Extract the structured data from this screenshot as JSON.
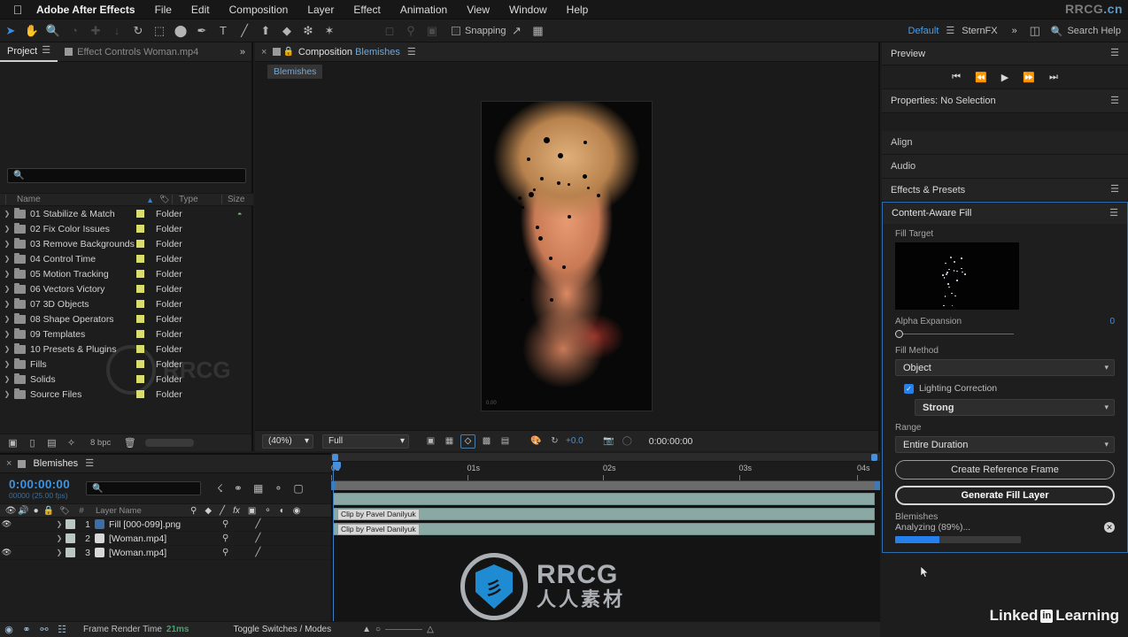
{
  "menubar": {
    "apple_icon": "apple-icon",
    "app_name": "Adobe After Effects",
    "items": [
      "File",
      "Edit",
      "Composition",
      "Layer",
      "Effect",
      "Animation",
      "View",
      "Window",
      "Help"
    ],
    "watermark_right": "RRCG",
    "watermark_right_suffix": ".cn"
  },
  "toolbar": {
    "tools": [
      {
        "name": "selection-tool",
        "glyph": "➤"
      },
      {
        "name": "hand-tool",
        "glyph": "✋"
      },
      {
        "name": "zoom-tool",
        "glyph": "🔍"
      },
      {
        "name": "orbit-tool",
        "glyph": "◔"
      },
      {
        "name": "pan-behind-tool",
        "glyph": "✚"
      },
      {
        "name": "move-tool",
        "glyph": "↓"
      },
      {
        "name": "rotation-tool",
        "glyph": "↺"
      },
      {
        "name": "anchor-point-tool",
        "glyph": "⬚"
      },
      {
        "name": "shape-tool",
        "glyph": "⬤"
      },
      {
        "name": "pen-tool",
        "glyph": "✒"
      },
      {
        "name": "type-tool",
        "glyph": "T"
      },
      {
        "name": "brush-tool",
        "glyph": "╱"
      },
      {
        "name": "clone-stamp-tool",
        "glyph": "⬆"
      },
      {
        "name": "eraser-tool",
        "glyph": "◆"
      },
      {
        "name": "roto-brush-tool",
        "glyph": "❇"
      },
      {
        "name": "puppet-pin-tool",
        "glyph": "✦"
      }
    ],
    "snapping_label": "Snapping",
    "workspace_active": "Default",
    "workspace_other": "SternFX",
    "workspace_more": "»",
    "search_help_placeholder": "Search Help"
  },
  "project_panel": {
    "tabs": [
      {
        "label": "Project",
        "active": true
      },
      {
        "label": "Effect Controls Woman.mp4",
        "active": false
      }
    ],
    "search_placeholder": "",
    "columns": [
      "Name",
      "Type",
      "Size"
    ],
    "items": [
      {
        "name": "01 Stabilize & Match",
        "type": "Folder",
        "size": "",
        "has_extra": true
      },
      {
        "name": "02 Fix Color Issues",
        "type": "Folder",
        "size": "",
        "has_extra": false
      },
      {
        "name": "03 Remove Backgrounds",
        "type": "Folder",
        "size": "",
        "has_extra": false
      },
      {
        "name": "04 Control Time",
        "type": "Folder",
        "size": "",
        "has_extra": false
      },
      {
        "name": "05 Motion Tracking",
        "type": "Folder",
        "size": "",
        "has_extra": false
      },
      {
        "name": "06 Vectors Victory",
        "type": "Folder",
        "size": "",
        "has_extra": false
      },
      {
        "name": "07 3D Objects",
        "type": "Folder",
        "size": "",
        "has_extra": false
      },
      {
        "name": "08 Shape Operators",
        "type": "Folder",
        "size": "",
        "has_extra": false
      },
      {
        "name": "09 Templates",
        "type": "Folder",
        "size": "",
        "has_extra": false
      },
      {
        "name": "10 Presets & Plugins",
        "type": "Folder",
        "size": "",
        "has_extra": false
      },
      {
        "name": "Fills",
        "type": "Folder",
        "size": "",
        "has_extra": false
      },
      {
        "name": "Solids",
        "type": "Folder",
        "size": "",
        "has_extra": false
      },
      {
        "name": "Source Files",
        "type": "Folder",
        "size": "",
        "has_extra": false
      }
    ],
    "footer": {
      "bit_depth": "8 bpc"
    }
  },
  "composition": {
    "tab_prefix": "Composition",
    "tab_name": "Blemishes",
    "breadcrumb": "Blemishes",
    "viewer_timecode_corner": "0.00",
    "toolbar": {
      "magnification": "(40%)",
      "resolution": "Full",
      "exposure_value": "+0.0",
      "timecode": "0:00:00:00"
    }
  },
  "right_panel": {
    "preview": {
      "title": "Preview"
    },
    "transport": [
      "first-frame",
      "prev-frame",
      "play",
      "next-frame",
      "last-frame"
    ],
    "properties": {
      "title": "Properties: No Selection"
    },
    "align": {
      "title": "Align"
    },
    "audio": {
      "title": "Audio"
    },
    "effects_presets": {
      "title": "Effects & Presets"
    },
    "content_aware_fill": {
      "title": "Content-Aware Fill",
      "fill_target_label": "Fill Target",
      "alpha_expansion_label": "Alpha Expansion",
      "alpha_expansion_value": "0",
      "fill_method_label": "Fill Method",
      "fill_method_value": "Object",
      "lighting_correction_label": "Lighting Correction",
      "lighting_correction_value": "Strong",
      "range_label": "Range",
      "range_value": "Entire Duration",
      "create_reference_frame": "Create Reference Frame",
      "generate_fill_layer": "Generate Fill Layer",
      "status_name": "Blemishes",
      "status_text": "Analyzing (89%)...",
      "progress_percent": 35
    },
    "brand": {
      "linkedin": "Linked",
      "in": "in",
      "learning": "Learning"
    }
  },
  "timeline": {
    "tab_name": "Blemishes",
    "current_time": "0:00:00:00",
    "frame_info": "00000 (25.00 fps)",
    "search_placeholder": "",
    "columns": {
      "number": "#",
      "layer_name": "Layer Name"
    },
    "layers": [
      {
        "num": "1",
        "name": "Fill  [000-099].png",
        "visible": true,
        "icon_color": "#3c6fa8",
        "swatch": "#b9c9c2"
      },
      {
        "num": "2",
        "name": "[Woman.mp4]",
        "visible": false,
        "icon_color": "#d8d8d8",
        "swatch": "#b9c9c2"
      },
      {
        "num": "3",
        "name": "[Woman.mp4]",
        "visible": true,
        "icon_color": "#d8d8d8",
        "swatch": "#b9c9c2"
      }
    ],
    "ruler_ticks": [
      "0s",
      "01s",
      "02s",
      "03s",
      "04s"
    ],
    "clip_labels": [
      "Clip by Pavel Danilyuk",
      "Clip by Pavel Danilyuk"
    ],
    "status": {
      "frame_render_label": "Frame Render Time",
      "frame_render_value": "21ms",
      "toggle_switches": "Toggle Switches / Modes"
    }
  },
  "watermark": {
    "brand": "RRCG",
    "brand_cn": "人人素材",
    "glyph": "彡"
  },
  "colors": {
    "accent_blue": "#2680eb",
    "panel_bg": "#1d1d1d",
    "header_bg": "#232323",
    "selection_border": "#2f6fb0",
    "folder_tag": "#d8dd6c",
    "clip_bar": "#8aa8a4",
    "playhead": "#d63a3a",
    "render_time": "#4e9e6f"
  }
}
